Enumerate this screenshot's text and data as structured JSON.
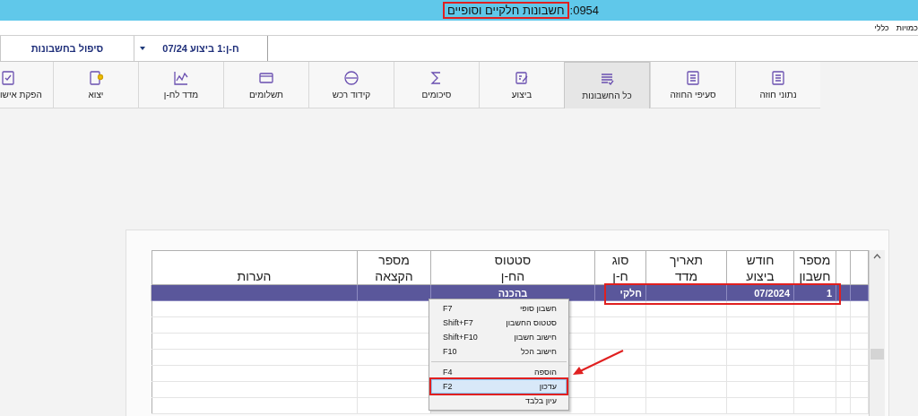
{
  "window": {
    "title": "חשבונות חלקיים וסופיים",
    "code": ":0954",
    "annotated": true
  },
  "menu": [
    "כמויות",
    "כללי"
  ],
  "selectors": [
    {
      "label": "ח-ן:1 ביצוע 07/24",
      "dropdown": true
    },
    {
      "label": "סיפול בחשבונות",
      "dropdown": false
    }
  ],
  "toolbar": [
    {
      "label": "נתוני חוזה",
      "selected": false
    },
    {
      "label": "סעיפי החוזה",
      "selected": false
    },
    {
      "label": "כל החשבונות",
      "selected": true
    },
    {
      "label": "ביצוע",
      "selected": false
    },
    {
      "label": "סיכומים",
      "selected": false
    },
    {
      "label": "קידוד רכש",
      "selected": false
    },
    {
      "label": "תשלומים",
      "selected": false
    },
    {
      "label": "מדד לח-ן",
      "selected": false
    },
    {
      "label": "יצוא",
      "selected": false
    },
    {
      "label": "הפקת אישו",
      "selected": false
    }
  ],
  "table": {
    "columns": [
      {
        "label": [
          "מספר",
          "חשבון"
        ]
      },
      {
        "label": [
          "חודש",
          "ביצוע"
        ]
      },
      {
        "label": [
          "תאריך",
          "מדד"
        ]
      },
      {
        "label": [
          "סוג",
          "ח-ן"
        ]
      },
      {
        "label": [
          "סטטוס",
          "הח-ן"
        ]
      },
      {
        "label": [
          "מספר",
          "הקצאה"
        ]
      },
      {
        "label": [
          "הערות"
        ]
      }
    ],
    "rows": [
      {
        "cells": {
          "account_number": "1",
          "execution_month": "07/2024",
          "type": "חלקי",
          "status": "בהכנה"
        },
        "selected": true,
        "annotated": true
      }
    ]
  },
  "context_menu": [
    {
      "kind": "item",
      "label": "חשבון סופי",
      "shortcut": "F7",
      "selected": false
    },
    {
      "kind": "item",
      "label": "סטטוס החשבון",
      "shortcut": "Shift+F7",
      "selected": false
    },
    {
      "kind": "item",
      "label": "חישוב חשבון",
      "shortcut": "Shift+F10",
      "selected": false
    },
    {
      "kind": "item",
      "label": "חישוב הכל",
      "shortcut": "F10",
      "selected": false
    },
    {
      "kind": "separator"
    },
    {
      "kind": "item",
      "label": "הוספה",
      "shortcut": "F4",
      "selected": false
    },
    {
      "kind": "item",
      "label": "עדכון",
      "shortcut": "F2",
      "selected": true,
      "annotated": true
    },
    {
      "kind": "item",
      "label": "עיון בלבד",
      "selected": false
    }
  ]
}
